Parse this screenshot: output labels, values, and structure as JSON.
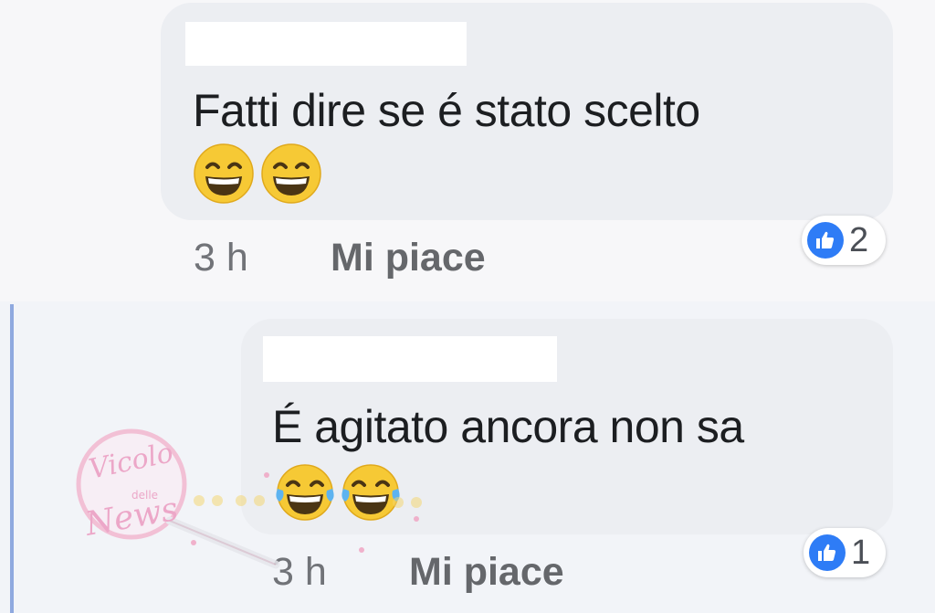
{
  "comments": [
    {
      "text": "Fatti dire se é stato scelto",
      "emojis": [
        "grinning-squinting-face",
        "grinning-squinting-face"
      ],
      "time": "3 h",
      "like_label": "Mi piace",
      "reaction_count": "2"
    },
    {
      "text": "É agitato ancora non sa",
      "emojis": [
        "face-with-tears-of-joy",
        "face-with-tears-of-joy"
      ],
      "time": "3 h",
      "like_label": "Mi piace",
      "reaction_count": "1"
    }
  ],
  "watermark": {
    "line1": "Vicolo",
    "line2": "delle",
    "line3": "News"
  },
  "colors": {
    "like_blue": "#2e7cf6",
    "thread_line": "#8fa9df",
    "bubble": "#eceef2"
  }
}
